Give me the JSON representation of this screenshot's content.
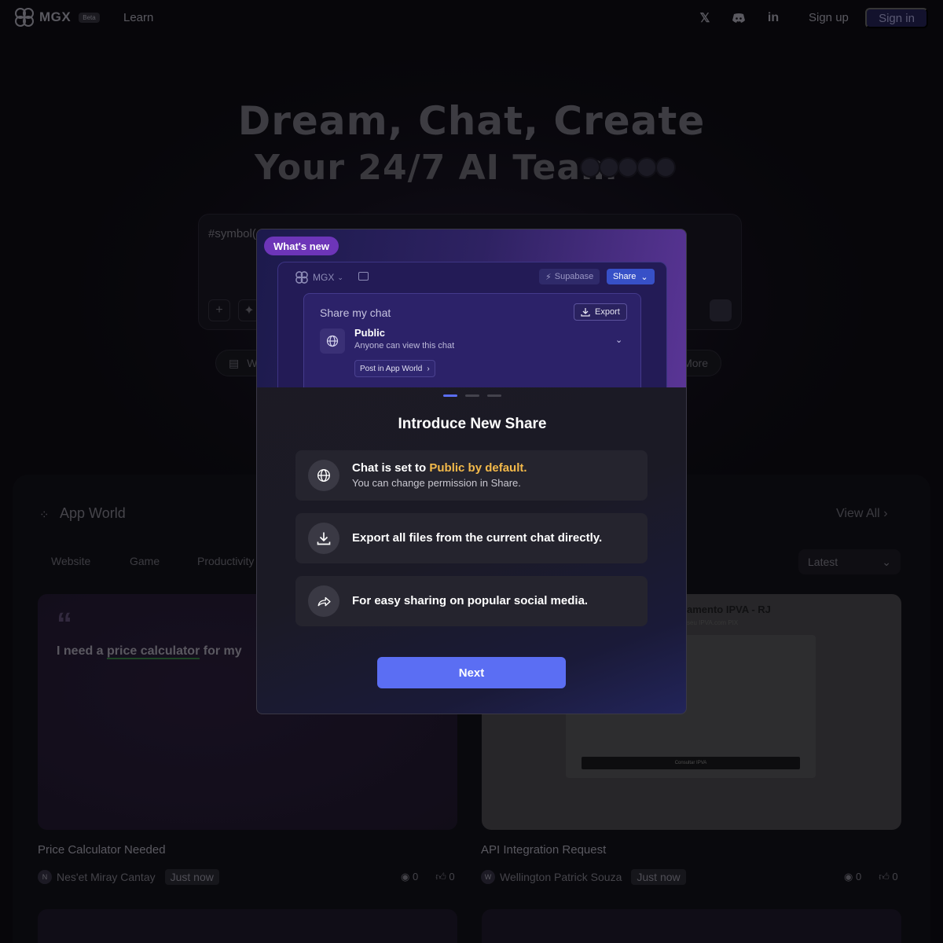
{
  "nav": {
    "logo_text": "MGX",
    "beta_label": "Beta",
    "learn": "Learn",
    "social_icons": [
      "x-icon",
      "discord-icon",
      "linkedin-icon"
    ],
    "sign_up": "Sign up",
    "sign_in": "Sign in"
  },
  "hero": {
    "line1": "Dream, Chat, Create",
    "line2": "Your 24/7 AI Team"
  },
  "prompt": {
    "text": "#symbol("
  },
  "chips": {
    "website": "W",
    "more": "More"
  },
  "app_world": {
    "title": "App World",
    "view_all": "View All",
    "tabs": [
      "Website",
      "Game",
      "Productivity"
    ],
    "sort_selected": "Latest",
    "cards": [
      {
        "quote_mark": "“",
        "text_before": "I need a ",
        "text_highlight": "price calculator",
        "text_after": " for my",
        "title": "Price Calculator Needed",
        "author_initial": "N",
        "author": "Nes'et Miray Cantay",
        "time": "Just now",
        "views": "0",
        "likes": "0"
      },
      {
        "preview_title": "amento IPVA - RJ",
        "preview_subtitle": "seu IPVA.com PIX",
        "preview_button": "Consultar IPVA",
        "title": "API Integration Request",
        "author_initial": "W",
        "author": "Wellington Patrick Souza",
        "time": "Just now",
        "views": "0",
        "likes": "0"
      }
    ]
  },
  "modal": {
    "badge": "What's new",
    "preview": {
      "logo": "MGX",
      "supabase": "Supabase",
      "share": "Share",
      "panel_title": "Share my chat",
      "export": "Export",
      "public": "Public",
      "public_sub": "Anyone can view this chat",
      "post": "Post in App World"
    },
    "title": "Introduce New Share",
    "features": [
      {
        "text": "Chat is set to ",
        "highlight": "Public by default.",
        "sub": "You can change permission in Share.",
        "icon": "globe-icon"
      },
      {
        "text": "Export all files from the current chat directly.",
        "icon": "download-icon"
      },
      {
        "text": "For easy sharing on popular social media.",
        "icon": "share-icon"
      }
    ],
    "pagination_total": 3,
    "pagination_active": 1,
    "next": "Next"
  },
  "colors": {
    "accent": "#5b6ef3",
    "highlight": "#f3b94a",
    "badge": "#6d35b8"
  }
}
